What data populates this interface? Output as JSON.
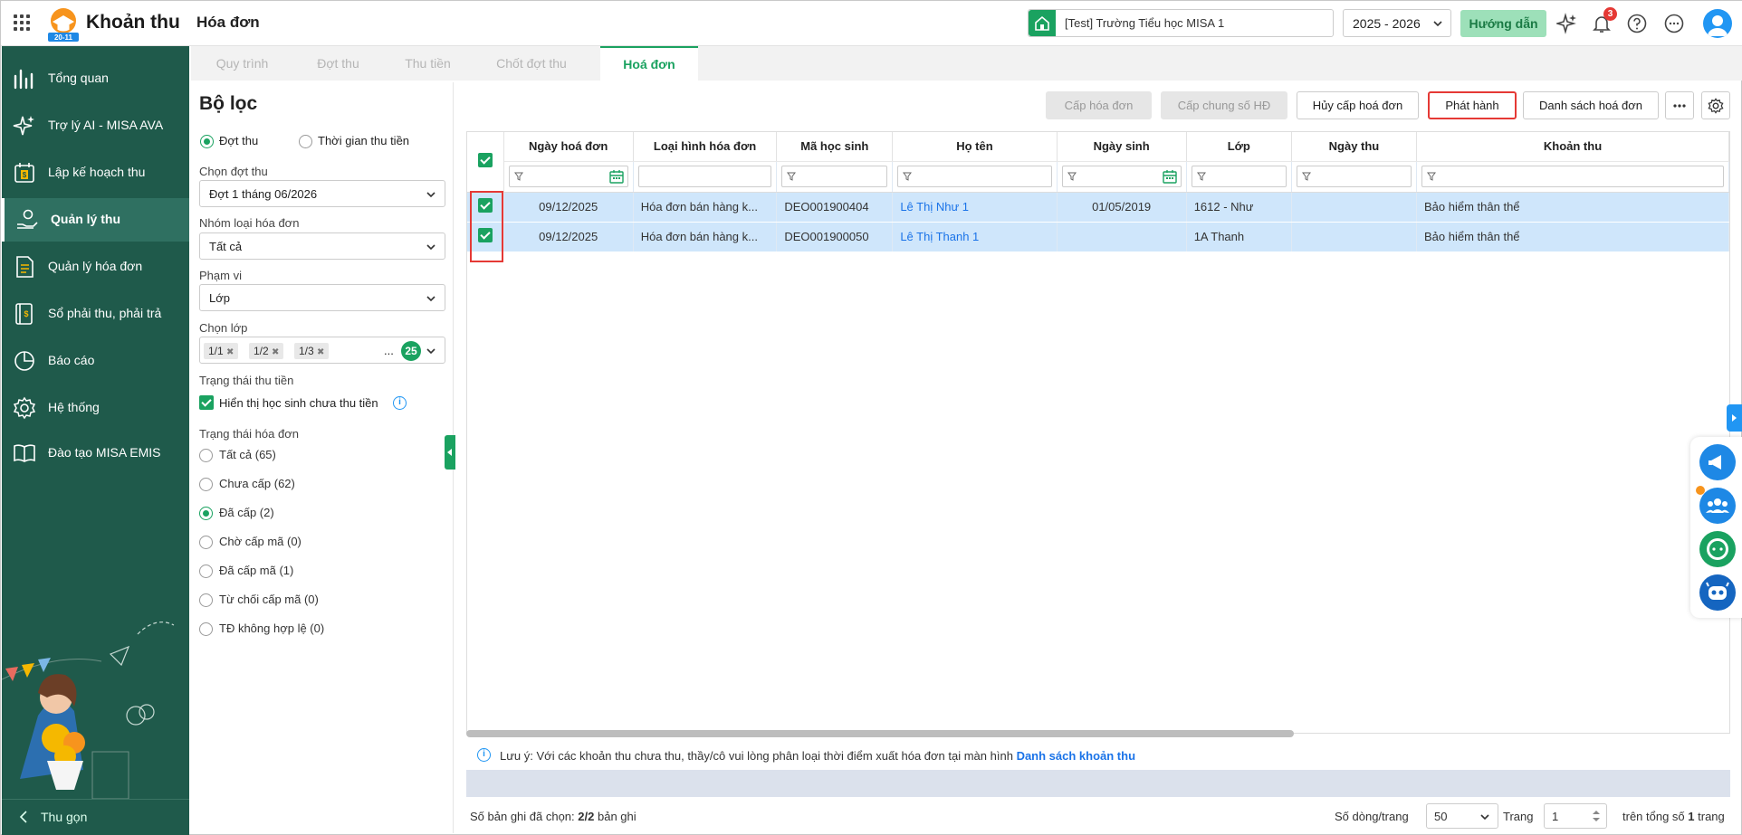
{
  "app": {
    "name": "Khoản thu",
    "logo_badge": "20-11",
    "page_title": "Hóa đơn"
  },
  "topbar": {
    "school": "[Test] Trường Tiểu học MISA 1",
    "year": "2025 - 2026",
    "guide_label": "Hướng dẫn",
    "notification_count": "3"
  },
  "sidebar": {
    "items": [
      {
        "label": "Tổng quan",
        "icon": "chart-bars-icon"
      },
      {
        "label": "Trợ lý AI - MISA AVA",
        "icon": "sparkle-icon"
      },
      {
        "label": "Lập kế hoạch thu",
        "icon": "calendar-dollar-icon"
      },
      {
        "label": "Quản lý thu",
        "icon": "hand-coin-icon",
        "active": true
      },
      {
        "label": "Quản lý hóa đơn",
        "icon": "document-icon"
      },
      {
        "label": "Sổ phải thu, phải trả",
        "icon": "ledger-icon"
      },
      {
        "label": "Báo cáo",
        "icon": "pie-chart-icon"
      },
      {
        "label": "Hệ thống",
        "icon": "gear-icon"
      },
      {
        "label": "Đào tạo MISA EMIS",
        "icon": "book-open-icon"
      }
    ],
    "collapse_label": "Thu gọn"
  },
  "tabs": [
    {
      "label": "Quy trình"
    },
    {
      "label": "Đợt thu"
    },
    {
      "label": "Thu tiền"
    },
    {
      "label": "Chốt đợt thu"
    },
    {
      "label": "Hoá đơn",
      "active": true
    }
  ],
  "filter": {
    "title": "Bộ lọc",
    "mode_options": [
      "Đợt thu",
      "Thời gian thu tiền"
    ],
    "period_label": "Chọn đợt thu",
    "period_value": "Đợt 1 tháng 06/2026",
    "invoice_group_label": "Nhóm loại hóa đơn",
    "invoice_group_value": "Tất cả",
    "scope_label": "Phạm vi",
    "scope_value": "Lớp",
    "class_label": "Chọn lớp",
    "class_chips": [
      "1/1",
      "1/2",
      "1/3"
    ],
    "class_more": "...",
    "class_count": "25",
    "payment_status_label": "Trạng thái thu tiền",
    "show_unpaid_label": "Hiển thị học sinh chưa thu tiền",
    "invoice_status_label": "Trạng thái hóa đơn",
    "invoice_status_options": [
      "Tất cả (65)",
      "Chưa cấp (62)",
      "Đã cấp (2)",
      "Chờ cấp mã (0)",
      "Đã cấp mã (1)",
      "Từ chối cấp mã (0)",
      "TĐ không hợp lệ (0)"
    ]
  },
  "toolbar": {
    "issue_invoice": "Cấp hóa đơn",
    "issue_common_no": "Cấp chung số HĐ",
    "cancel_issue": "Hủy cấp hoá đơn",
    "publish": "Phát hành",
    "invoice_list": "Danh sách hoá đơn"
  },
  "table": {
    "columns": [
      "Ngày hoá đơn",
      "Loại hình hóa đơn",
      "Mã học sinh",
      "Họ tên",
      "Ngày sinh",
      "Lớp",
      "Ngày thu",
      "Khoản thu"
    ],
    "rows": [
      {
        "date": "09/12/2025",
        "type": "Hóa đơn bán hàng k...",
        "code": "DEO001900404",
        "name": "Lê Thị Như 1",
        "dob": "01/05/2019",
        "class": "1612 - Như",
        "paid_date": "",
        "item": "Bảo hiểm thân thể"
      },
      {
        "date": "09/12/2025",
        "type": "Hóa đơn bán hàng k...",
        "code": "DEO001900050",
        "name": "Lê Thị Thanh 1",
        "dob": "",
        "class": "1A Thanh",
        "paid_date": "",
        "item": "Bảo hiểm thân thể"
      }
    ]
  },
  "note": {
    "prefix": "Lưu ý: Với các khoản thu chưa thu, thầy/cô vui lòng phân loại thời điểm xuất hóa đơn tại màn hình",
    "link": "Danh sách khoản thu"
  },
  "footer": {
    "selected_prefix": "Số bản ghi đã chọn:",
    "selected_value": "2/2",
    "selected_suffix": "bản ghi",
    "rows_per_page_label": "Số dòng/trang",
    "rows_per_page": "50",
    "page_label": "Trang",
    "page": "1",
    "total_prefix": "trên tổng số",
    "total_pages": "1",
    "total_suffix": "trang"
  },
  "colors": {
    "brand_green": "#1aa260",
    "sidebar_bg": "#1f5a4b",
    "selected_row": "#cfe6fb",
    "highlight_red": "#e53935",
    "link_blue": "#1a73e8"
  }
}
